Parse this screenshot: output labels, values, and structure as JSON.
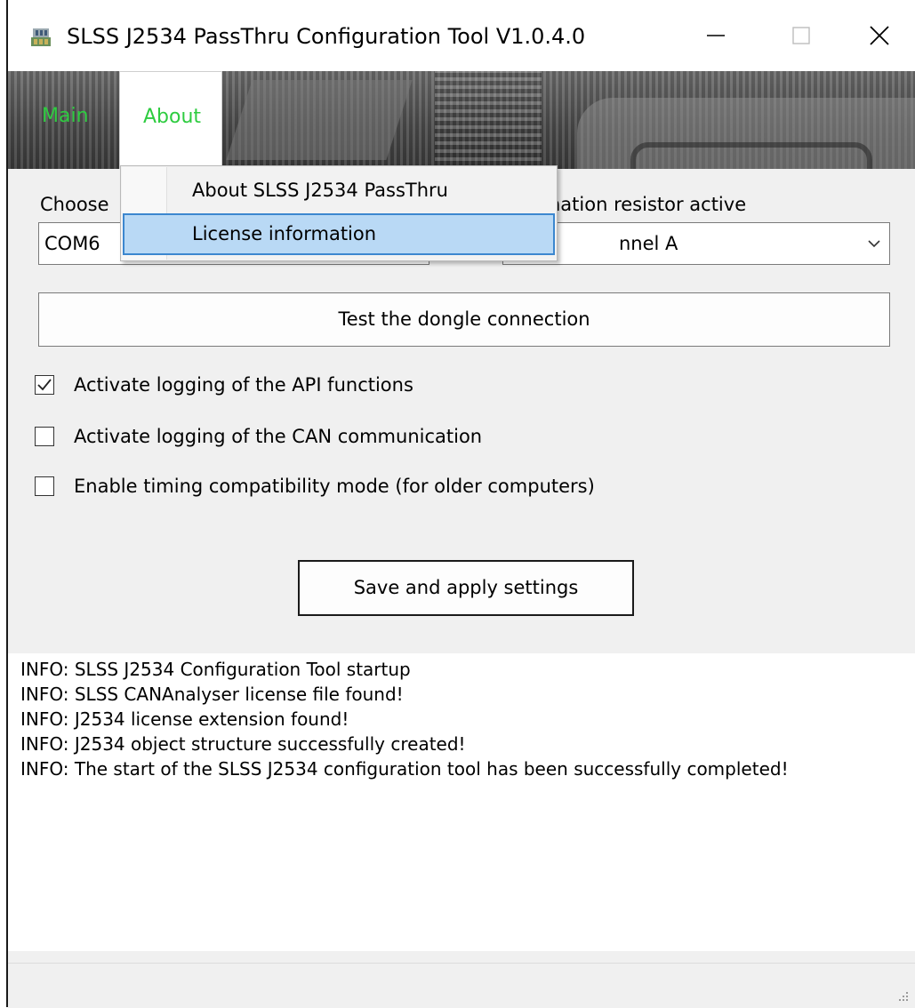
{
  "window": {
    "title": "SLSS J2534 PassThru Configuration Tool V1.0.4.0",
    "controls": {
      "minimize": "—",
      "maximize": "☐",
      "close": "✕"
    }
  },
  "menu": {
    "main_label": "Main",
    "about_label": "About",
    "about_dropdown": {
      "items": [
        "About SLSS J2534 PassThru",
        "License information"
      ],
      "highlighted": "License information"
    },
    "colors": {
      "menu_text": "#2ecc40",
      "highlight": "#b9d9f5",
      "highlight_border": "#3c87cf"
    }
  },
  "form": {
    "com_label": "Choose",
    "com_value": "COM6",
    "termination_label": "nation resistor active",
    "channel_value": "nnel A",
    "test_button_label": "Test the dongle connection",
    "checkboxes": [
      {
        "label": "Activate logging of the API functions",
        "checked": true
      },
      {
        "label": "Activate logging of the CAN communication",
        "checked": false
      },
      {
        "label": "Enable timing compatibility mode (for older computers)",
        "checked": false
      }
    ],
    "save_button_label": "Save and apply settings"
  },
  "log": {
    "lines": [
      "INFO: SLSS J2534 Configuration Tool startup",
      "INFO: SLSS CANAnalyser license file found!",
      "INFO: J2534 license extension found!",
      "INFO: J2534 object structure successfully created!",
      "INFO: The start of the SLSS J2534 configuration tool has been successfully completed!"
    ]
  },
  "icons": {
    "app": "app-icon",
    "dropdown_arrow": "chevron-down-icon",
    "checkmark": "checkmark-icon",
    "grip": "resize-grip-icon"
  }
}
